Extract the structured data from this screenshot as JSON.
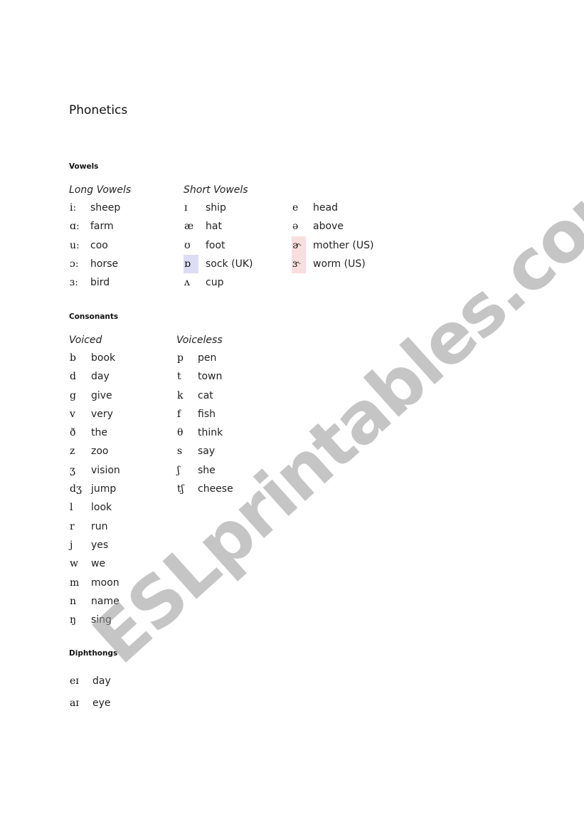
{
  "title": "Phonetics",
  "watermark": "ESLprintables.com",
  "vowels": {
    "heading": "Vowels",
    "long": {
      "label": "Long Vowels",
      "items": [
        {
          "symbol": "iː",
          "word": "sheep"
        },
        {
          "symbol": "ɑː",
          "word": "farm"
        },
        {
          "symbol": "uː",
          "word": "coo"
        },
        {
          "symbol": "ɔː",
          "word": "horse"
        },
        {
          "symbol": "ɜː",
          "word": "bird"
        }
      ]
    },
    "short": {
      "label": "Short Vowels",
      "items": [
        {
          "symbol": "ɪ",
          "word": "ship"
        },
        {
          "symbol": "æ",
          "word": "hat"
        },
        {
          "symbol": "ʊ",
          "word": "foot"
        },
        {
          "symbol": "ɒ",
          "word": "sock (UK)",
          "highlight": "#dcdcf4"
        },
        {
          "symbol": "ʌ",
          "word": "cup"
        }
      ]
    },
    "other": {
      "items": [
        {
          "symbol": "e",
          "word": "head"
        },
        {
          "symbol": "ə",
          "word": "above"
        },
        {
          "symbol": "ɚ",
          "word": "mother (US)",
          "highlight": "#f8dede"
        },
        {
          "symbol": "ɝ",
          "word": "worm (US)",
          "highlight": "#f8dede"
        }
      ]
    }
  },
  "consonants": {
    "heading": "Consonants",
    "voiced": {
      "label": "Voiced",
      "items": [
        {
          "symbol": "b",
          "word": "book"
        },
        {
          "symbol": "d",
          "word": "day"
        },
        {
          "symbol": "g",
          "word": "give"
        },
        {
          "symbol": "v",
          "word": "very"
        },
        {
          "symbol": "ð",
          "word": "the"
        },
        {
          "symbol": "z",
          "word": "zoo"
        },
        {
          "symbol": "ʒ",
          "word": "vision"
        },
        {
          "symbol": "dʒ",
          "word": "jump"
        },
        {
          "symbol": "l",
          "word": "look"
        },
        {
          "symbol": "r",
          "word": "run"
        },
        {
          "symbol": "j",
          "word": "yes"
        },
        {
          "symbol": "w",
          "word": "we"
        },
        {
          "symbol": "m",
          "word": "moon"
        },
        {
          "symbol": "n",
          "word": "name"
        },
        {
          "symbol": "ŋ",
          "word": "sing"
        }
      ]
    },
    "voiceless": {
      "label": "Voiceless",
      "items": [
        {
          "symbol": "p",
          "word": "pen"
        },
        {
          "symbol": "t",
          "word": "town"
        },
        {
          "symbol": "k",
          "word": "cat"
        },
        {
          "symbol": "f",
          "word": "fish"
        },
        {
          "symbol": "θ",
          "word": "think"
        },
        {
          "symbol": "s",
          "word": "say"
        },
        {
          "symbol": "ʃ",
          "word": "she"
        },
        {
          "symbol": "tʃ",
          "word": "cheese"
        }
      ]
    }
  },
  "diphthongs": {
    "heading": "Diphthongs",
    "items": [
      {
        "symbol": "eɪ",
        "word": "day"
      },
      {
        "symbol": "aɪ",
        "word": "eye"
      }
    ]
  }
}
